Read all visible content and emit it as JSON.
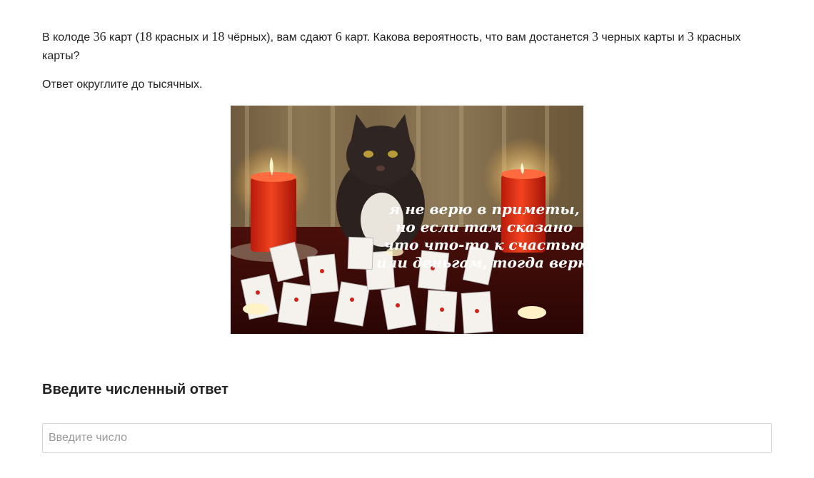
{
  "problem": {
    "part1": "В колоде ",
    "n_total": "36",
    "part2": " карт (",
    "n_red": "18",
    "part3": " красных и ",
    "n_black": "18",
    "part4": " чёрных), вам сдают ",
    "n_dealt": "6",
    "part5": " карт. Какова вероятность, что вам достанется ",
    "n_black_wanted": "3",
    "part6": " черных карты и ",
    "n_red_wanted": "3",
    "part7": " красных карты?"
  },
  "rounding_note": "Ответ округлите до тысячных.",
  "image": {
    "caption_lines": [
      "я не верю в приметы,",
      "но если там сказано",
      "что что-то к счастью",
      "или деньгам, тогда верю"
    ]
  },
  "answer": {
    "title": "Введите численный ответ",
    "placeholder": "Введите число",
    "value": ""
  }
}
